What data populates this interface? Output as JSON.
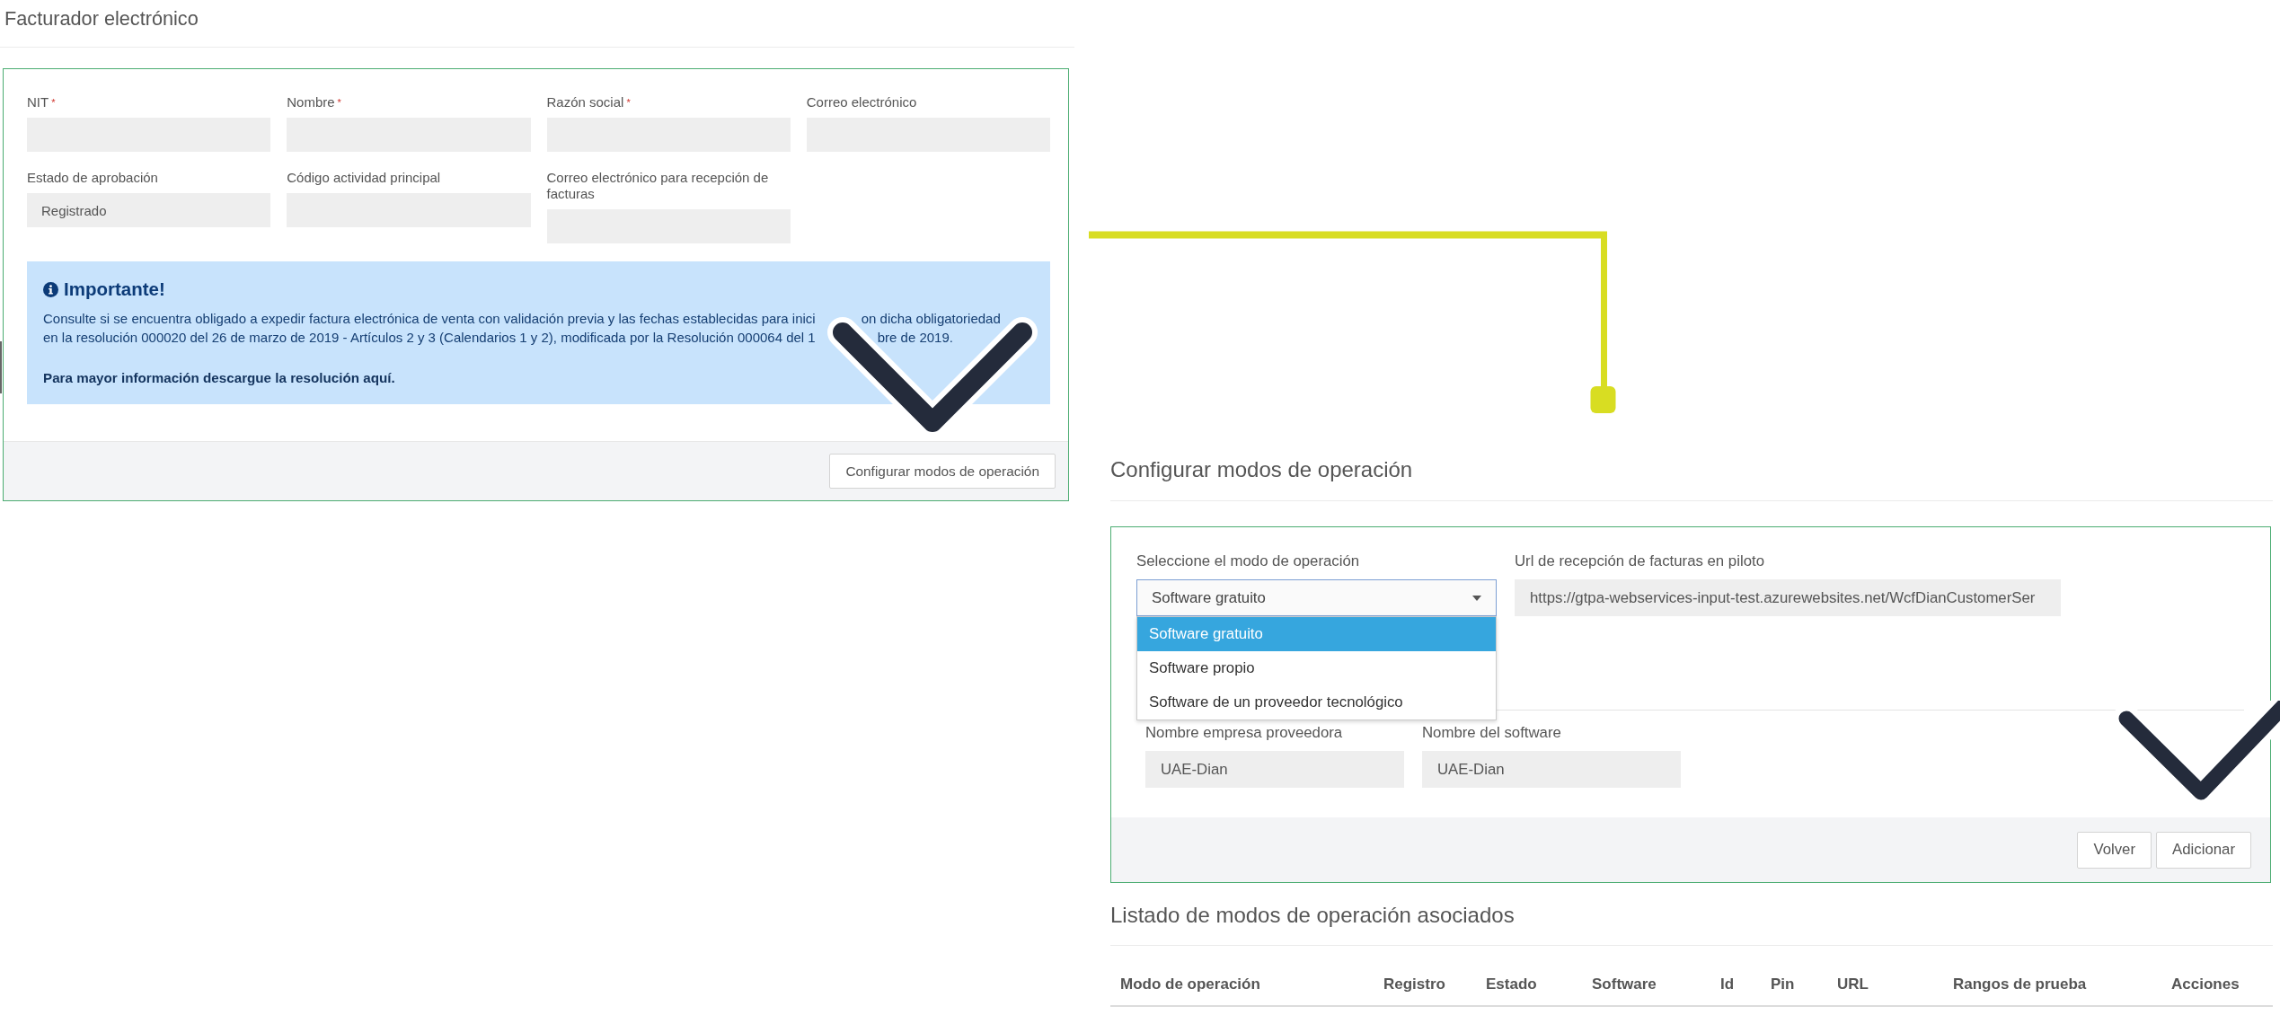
{
  "billing_issuer": {
    "title": "Facturador electrónico",
    "fields": [
      {
        "label": "NIT",
        "required_mark": "*"
      },
      {
        "label": "Nombre",
        "required_mark": "*"
      },
      {
        "label": "Razón social",
        "required_mark": "*"
      },
      {
        "label": "Correo electrónico"
      },
      {
        "label": "Estado de aprobación",
        "value": "Registrado"
      },
      {
        "label": "Código actividad principal"
      },
      {
        "label": "Correo electrónico para recepción de facturas"
      }
    ],
    "notice": {
      "title": "Importante!",
      "lines": [
        [
          "Consulte si se encuentra obligado a expedir factura electrónica de venta con validación previa y las fechas establecidas para inici",
          "on dicha obligatoriedad"
        ],
        [
          "en la resolución 000020 del 26 de marzo de 2019 - Artículos 2 y 3 (Calendarios 1 y 2), modificada por la Resolución 000064 del 1",
          "bre de 2019."
        ]
      ],
      "note": "Para mayor información descargue la resolución aquí."
    },
    "button": "Configurar modos de operación"
  },
  "operation_modes": {
    "title": "Configurar modos de operación",
    "mode_select": {
      "label": "Seleccione el modo de operación",
      "value": "Software gratuito",
      "expanded": true,
      "options": [
        {
          "label": "Software gratuito",
          "selected": true
        },
        {
          "label": "Software propio",
          "selected": false
        },
        {
          "label": "Software de un proveedor tecnológico",
          "selected": false
        }
      ]
    },
    "url_field": {
      "label": "Url de recepción de facturas en piloto",
      "value": "https://gtpa-webservices-input-test.azurewebsites.net/WcfDianCustomerSer"
    },
    "provider_fields": [
      {
        "label": "Nombre empresa proveedora",
        "value": "UAE-Dian"
      },
      {
        "label": "Nombre del software",
        "value": "UAE-Dian"
      }
    ],
    "buttons": [
      {
        "label": "Volver"
      },
      {
        "label": "Adicionar"
      }
    ]
  },
  "associated_modes": {
    "title": "Listado de modos de operación asociados",
    "columns": [
      "Modo de operación",
      "Registro",
      "Estado",
      "Software",
      "Id",
      "Pin",
      "URL",
      "Rangos de prueba",
      "Acciones"
    ]
  }
}
